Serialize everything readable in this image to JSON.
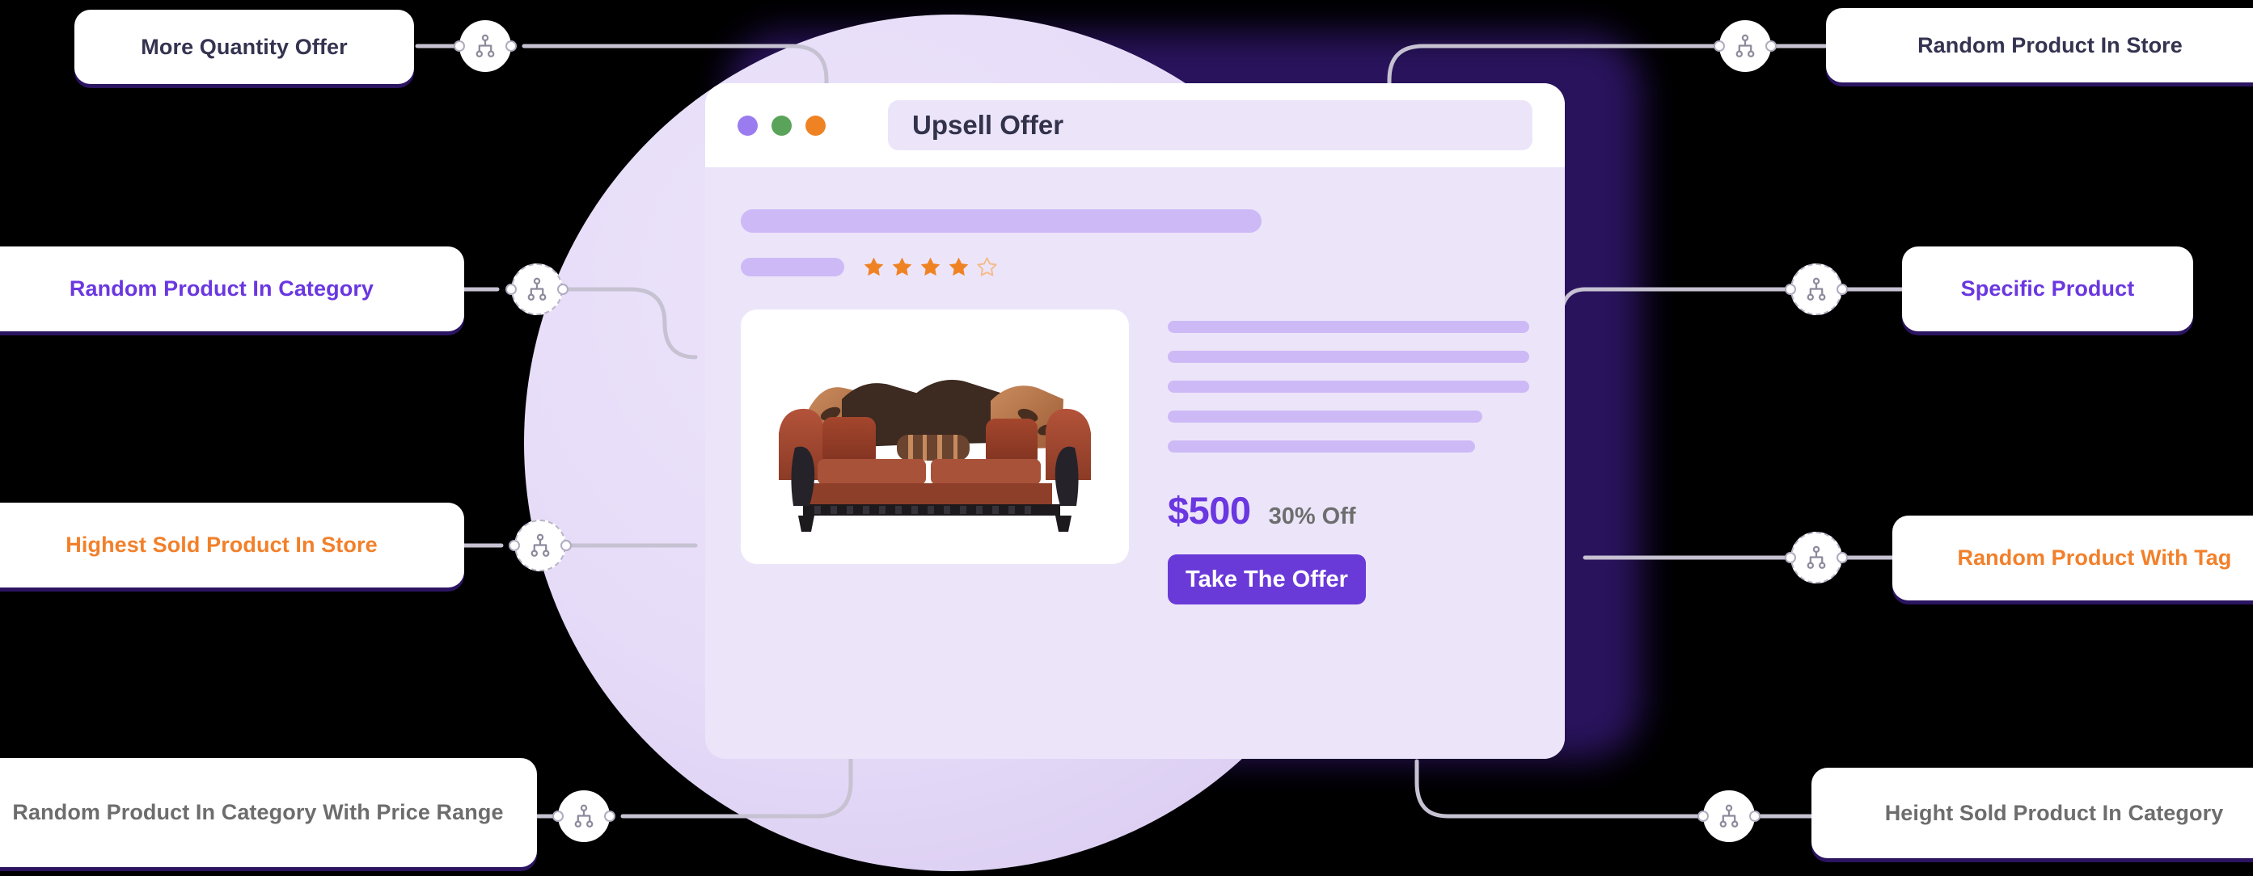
{
  "background": {
    "blob_color": "#2b1460",
    "circle_color": "#e6dcf8",
    "canvas_color": "#000000"
  },
  "node_icon_name": "hierarchy-icon",
  "left_labels": [
    {
      "id": "more-quantity-offer",
      "text": "More Quantity Offer",
      "color_class": "c-navy",
      "color": "#343350"
    },
    {
      "id": "random-product-in-category",
      "text": "Random Product In Category",
      "color_class": "c-purple",
      "color": "#6a37e0"
    },
    {
      "id": "highest-sold-product-in-store",
      "text": "Highest Sold Product In Store",
      "color_class": "c-orange",
      "color": "#f2802a"
    },
    {
      "id": "random-product-in-category-with-price-range",
      "text": "Random Product In Category With Price Range",
      "color_class": "c-gray",
      "color": "#6d6d6d"
    }
  ],
  "right_labels": [
    {
      "id": "random-product-in-store",
      "text": "Random Product In Store",
      "color_class": "c-navy",
      "color": "#343350"
    },
    {
      "id": "specific-product",
      "text": "Specific Product",
      "color_class": "c-purple",
      "color": "#6a37e0"
    },
    {
      "id": "random-product-with-tag",
      "text": "Random Product With Tag",
      "color_class": "c-orange",
      "color": "#f2802a"
    },
    {
      "id": "height-sold-product-in-category",
      "text": "Height Sold Product In Category",
      "color_class": "c-gray",
      "color": "#6d6d6d"
    }
  ],
  "browser": {
    "traffic_lights": [
      {
        "name": "purple-dot",
        "color": "#9b7cf0"
      },
      {
        "name": "green-dot",
        "color": "#5aa35a"
      },
      {
        "name": "orange-dot",
        "color": "#ef8323"
      }
    ],
    "title": "Upsell Offer",
    "rating": {
      "filled": 4,
      "total": 5,
      "color": "#ef8323"
    },
    "product_image_alt": "rust brown sofa with pillows",
    "price": "$500",
    "discount": "30% Off",
    "cta_label": "Take The Offer",
    "cta_color": "#6a3ad8",
    "price_color": "#6a37e0",
    "skeleton_lines": [
      100,
      100,
      100,
      87,
      85
    ]
  }
}
